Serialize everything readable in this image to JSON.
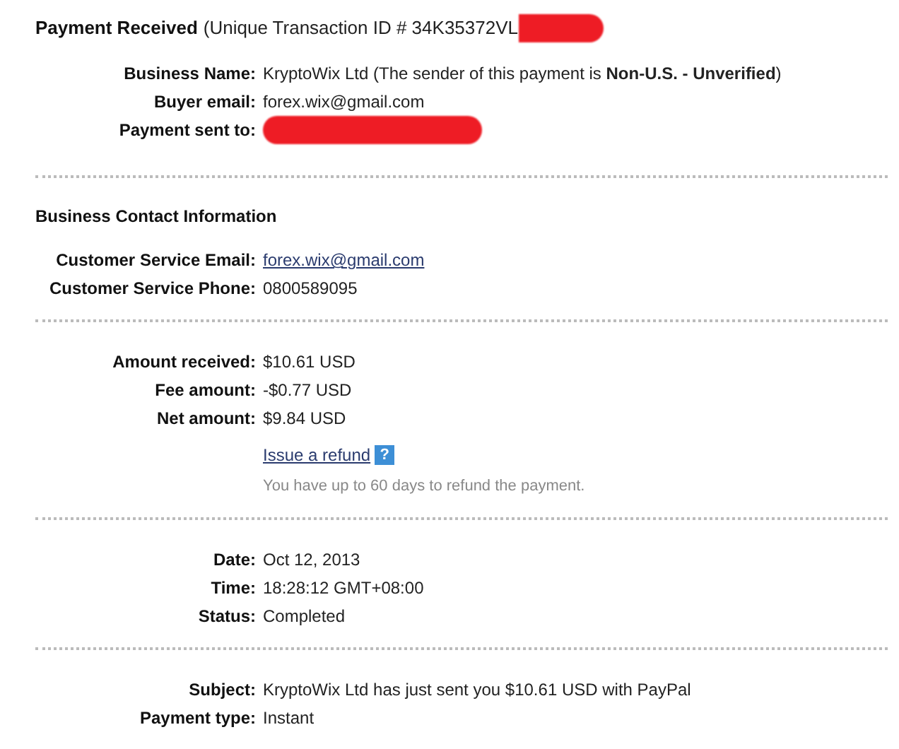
{
  "header": {
    "title": "Payment Received",
    "transaction": "(Unique Transaction ID # 34K35372VL"
  },
  "sections": [
    {
      "rows": [
        {
          "kind": "rich",
          "label": "Business Name:",
          "value": "KryptoWix Ltd (The sender of this payment is **Non-U.S. - Unverified**)"
        },
        {
          "kind": "text",
          "label": "Buyer email:",
          "value": "forex.wix@gmail.com"
        },
        {
          "kind": "redacted",
          "label": "Payment sent to:"
        }
      ]
    },
    {
      "heading": "Business Contact Information",
      "rows": [
        {
          "kind": "link",
          "label": "Customer Service Email:",
          "value": "forex.wix@gmail.com"
        },
        {
          "kind": "text",
          "label": "Customer Service Phone:",
          "value": "0800589095"
        }
      ]
    },
    {
      "rows": [
        {
          "kind": "text",
          "label": "Amount received:",
          "value": "$10.61 USD"
        },
        {
          "kind": "text",
          "label": "Fee amount:",
          "value": "-$0.77 USD"
        },
        {
          "kind": "text",
          "label": "Net amount:",
          "value": "$9.84 USD"
        },
        {
          "kind": "refund",
          "value": "Issue a refund",
          "help": "?"
        },
        {
          "kind": "note",
          "value": "You have up to 60 days to refund the payment."
        }
      ]
    },
    {
      "rows": [
        {
          "kind": "text",
          "label": "Date:",
          "value": "Oct 12, 2013"
        },
        {
          "kind": "text",
          "label": "Time:",
          "value": "18:28:12 GMT+08:00"
        },
        {
          "kind": "text",
          "label": "Status:",
          "value": "Completed"
        }
      ]
    },
    {
      "rows": [
        {
          "kind": "text",
          "label": "Subject:",
          "value": "KryptoWix Ltd has just sent you $10.61 USD with PayPal"
        },
        {
          "kind": "text",
          "label": "Payment type:",
          "value": "Instant"
        }
      ]
    }
  ]
}
